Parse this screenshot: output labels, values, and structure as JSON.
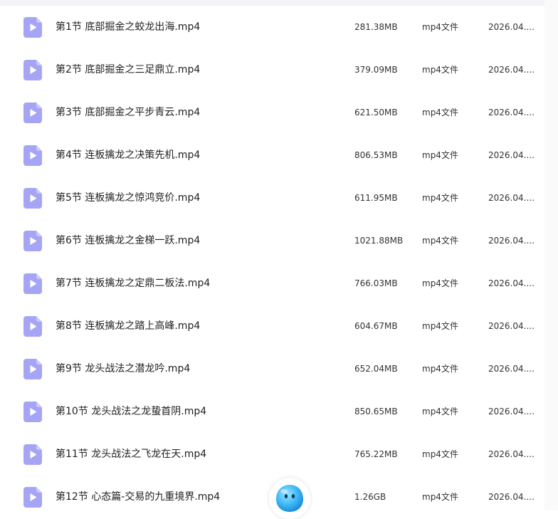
{
  "theme": {
    "icon_color": "#a6a5f5",
    "icon_fold_color": "#c9c8fb",
    "assistant_color": "#3fb8f5"
  },
  "files": [
    {
      "name": "第1节 底部掘金之蛟龙出海.mp4",
      "size": "281.38MB",
      "type": "mp4文件",
      "date": "2026.04...."
    },
    {
      "name": "第2节 底部掘金之三足鼎立.mp4",
      "size": "379.09MB",
      "type": "mp4文件",
      "date": "2026.04...."
    },
    {
      "name": "第3节 底部掘金之平步青云.mp4",
      "size": "621.50MB",
      "type": "mp4文件",
      "date": "2026.04...."
    },
    {
      "name": "第4节 连板擒龙之决策先机.mp4",
      "size": "806.53MB",
      "type": "mp4文件",
      "date": "2026.04...."
    },
    {
      "name": "第5节 连板擒龙之惊鸿竞价.mp4",
      "size": "611.95MB",
      "type": "mp4文件",
      "date": "2026.04...."
    },
    {
      "name": "第6节 连板擒龙之金梯一跃.mp4",
      "size": "1021.88MB",
      "type": "mp4文件",
      "date": "2026.04...."
    },
    {
      "name": "第7节 连板擒龙之定鼎二板法.mp4",
      "size": "766.03MB",
      "type": "mp4文件",
      "date": "2026.04...."
    },
    {
      "name": "第8节 连板擒龙之踏上高峰.mp4",
      "size": "604.67MB",
      "type": "mp4文件",
      "date": "2026.04...."
    },
    {
      "name": "第9节 龙头战法之潜龙吟.mp4",
      "size": "652.04MB",
      "type": "mp4文件",
      "date": "2026.04...."
    },
    {
      "name": "第10节 龙头战法之龙蛰首阴.mp4",
      "size": "850.65MB",
      "type": "mp4文件",
      "date": "2026.04...."
    },
    {
      "name": "第11节 龙头战法之飞龙在天.mp4",
      "size": "765.22MB",
      "type": "mp4文件",
      "date": "2026.04...."
    },
    {
      "name": "第12节 心态篇-交易的九重境界.mp4",
      "size": "1.26GB",
      "type": "mp4文件",
      "date": "2026.04...."
    }
  ]
}
